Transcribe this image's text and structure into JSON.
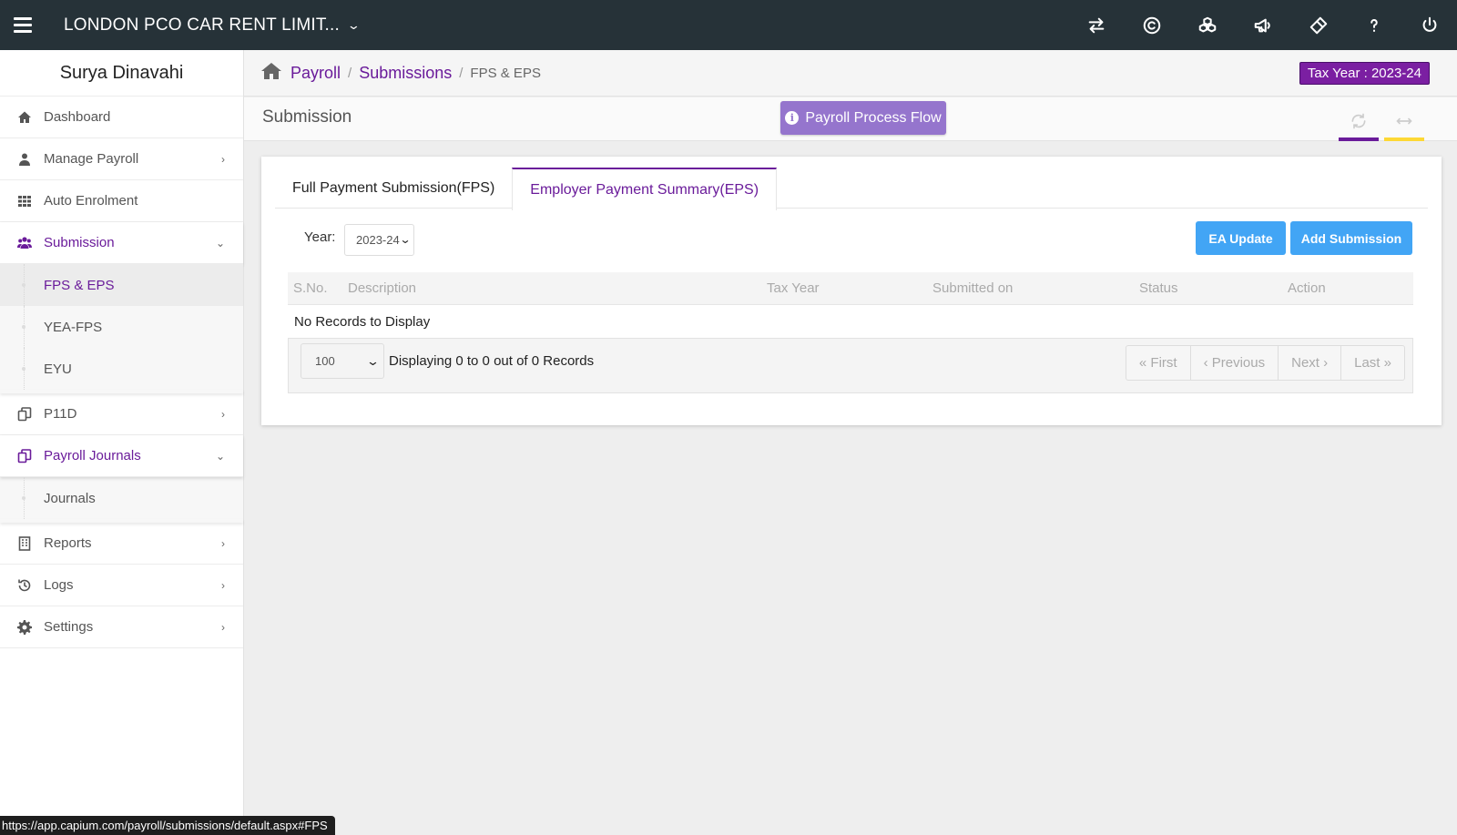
{
  "topbar": {
    "company": "LONDON PCO CAR RENT LIMIT...",
    "icons": [
      "swap-icon",
      "copyright-icon",
      "cubes-icon",
      "megaphone-icon",
      "ticket-icon",
      "help-icon",
      "power-icon"
    ]
  },
  "sidebar": {
    "user_name": "Surya Dinavahi",
    "items": {
      "dashboard": "Dashboard",
      "manage_payroll": "Manage Payroll",
      "auto_enrolment": "Auto Enrolment",
      "submission": "Submission",
      "fps_eps": "FPS & EPS",
      "yea_fps": "YEA-FPS",
      "eyu": "EYU",
      "p11d": "P11D",
      "payroll_journals": "Payroll Journals",
      "journals": "Journals",
      "reports": "Reports",
      "logs": "Logs",
      "settings": "Settings"
    }
  },
  "breadcrumb": {
    "payroll": "Payroll",
    "submissions": "Submissions",
    "current": "FPS & EPS",
    "sep": "/"
  },
  "tax_year_badge": "Tax Year : 2023-24",
  "page": {
    "title": "Submission",
    "process_flow_button": "Payroll Process Flow"
  },
  "tabs": {
    "fps": "Full Payment Submission(FPS)",
    "eps": "Employer Payment Summary(EPS)"
  },
  "filters": {
    "year_label": "Year:",
    "year_value": "2023-24"
  },
  "buttons": {
    "ea_update": "EA Update",
    "add_submission": "Add Submission"
  },
  "table": {
    "columns": {
      "sno": "S.No.",
      "description": "Description",
      "tax_year": "Tax Year",
      "submitted_on": "Submitted on",
      "status": "Status",
      "action": "Action"
    },
    "empty_message": "No Records to Display"
  },
  "pagination": {
    "page_size": "100",
    "info": "Displaying 0 to 0 out of 0 Records",
    "first": "« First",
    "previous": "‹ Previous",
    "next": "Next ›",
    "last": "Last »"
  },
  "status_url": "https://app.capium.com/payroll/submissions/default.aspx#FPS",
  "colors": {
    "topbar": "#263238",
    "accent_purple": "#6a1b9a",
    "process_button": "#9575cd",
    "primary_blue": "#42a5f5",
    "accent_yellow": "#fdd835"
  }
}
